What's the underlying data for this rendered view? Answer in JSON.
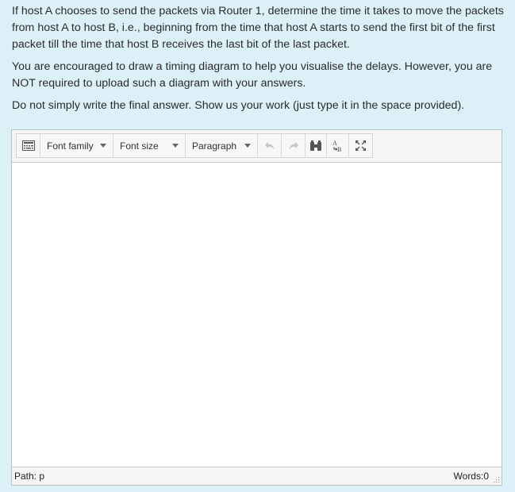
{
  "question": {
    "paragraphs": [
      "If host A chooses to send the packets via Router 1, determine the time it takes to move the packets from host A to host B, i.e., beginning from the time that host A starts to send the first bit of the first packet till the time that host B receives the last bit of the last packet.",
      "You are encouraged to draw a timing diagram to help you visualise the delays. However, you are NOT required to upload such a diagram with your answers.",
      "Do not simply write the final answer. Show us your work (just type it in the space provided)."
    ]
  },
  "editor": {
    "toolbar": {
      "toggle_icon": "toolbar-toggle-icon",
      "font_family": "Font family",
      "font_size": "Font size",
      "format": "Paragraph",
      "icons": [
        "undo-icon",
        "redo-icon",
        "find-icon",
        "spellcheck-icon",
        "fullscreen-icon"
      ]
    },
    "status": {
      "path": "Path: p",
      "words": "Words:0"
    }
  },
  "colors": {
    "page_bg": "#dcf1f7",
    "toolbar_bg": "#f5f5f5",
    "border": "#bfbfbf"
  }
}
